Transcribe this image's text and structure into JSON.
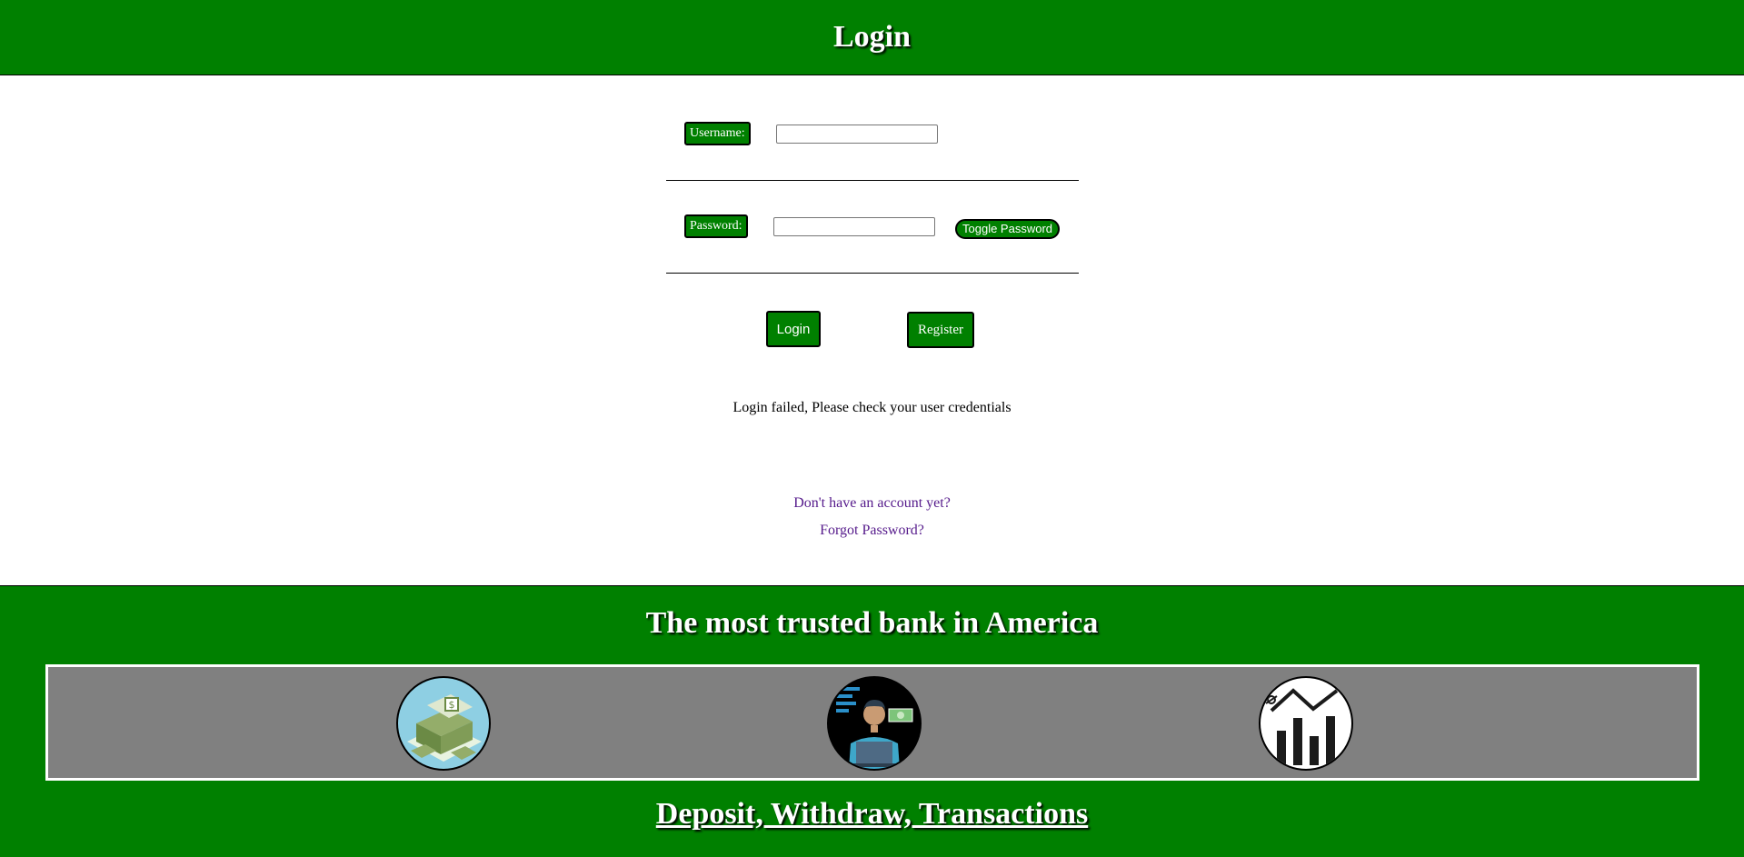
{
  "header": {
    "title": "Login"
  },
  "form": {
    "username_label": "Username:",
    "username_value": "",
    "password_label": "Password:",
    "password_value": "",
    "toggle_password_label": "Toggle Password",
    "login_label": "Login",
    "register_label": "Register"
  },
  "status": {
    "error_message": "Login failed, Please check your user credentials"
  },
  "links": {
    "no_account": "Don't have an account yet?",
    "forgot_password": "Forgot Password?"
  },
  "footer": {
    "tagline": "The most trusted bank in America",
    "features_heading": "Deposit, Withdraw, Transactions",
    "images": [
      "money-stack-icon",
      "banker-with-laptop-icon",
      "growth-chart-icon"
    ]
  },
  "colors": {
    "brand_green": "#008000",
    "gallery_gray": "#808080",
    "link_purple": "#551a8b"
  }
}
